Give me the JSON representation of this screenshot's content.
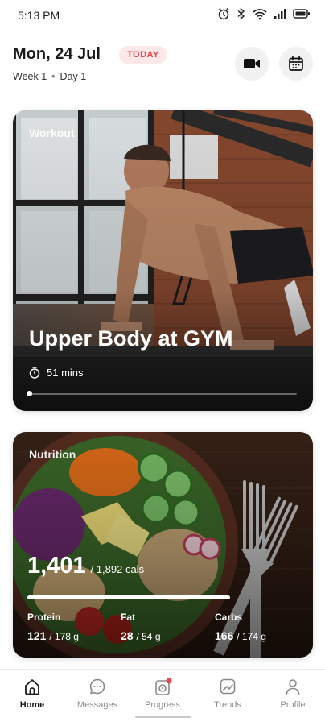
{
  "status_bar": {
    "time": "5:13 PM",
    "icons": [
      "alarm-icon",
      "bluetooth-icon",
      "wifi-icon",
      "signal-icon",
      "battery-icon"
    ]
  },
  "header": {
    "date": "Mon, 24 Jul",
    "today_badge": "TODAY",
    "week": "Week 1",
    "day": "Day 1",
    "actions": [
      "video-camera-icon",
      "calendar-icon"
    ],
    "badge_color": "#e5484d"
  },
  "workout": {
    "label": "Workout",
    "title": "Upper Body at GYM",
    "duration": "51 mins",
    "progress": 0.0
  },
  "nutrition": {
    "label": "Nutrition",
    "calories_consumed": "1,401",
    "calories_goal_text": "/ 1,892 cals",
    "calories_fraction": 0.74,
    "macros": [
      {
        "label": "Protein",
        "value": "121",
        "total": "/ 178 g"
      },
      {
        "label": "Fat",
        "value": "28",
        "total": "/ 54 g"
      },
      {
        "label": "Carbs",
        "value": "166",
        "total": "/ 174 g"
      }
    ]
  },
  "bottom_nav": {
    "items": [
      {
        "label": "Home",
        "icon": "home-icon",
        "active": true
      },
      {
        "label": "Messages",
        "icon": "messages-icon",
        "active": false
      },
      {
        "label": "Progress",
        "icon": "progress-icon",
        "active": false,
        "notification_dot": true
      },
      {
        "label": "Trends",
        "icon": "trends-icon",
        "active": false
      },
      {
        "label": "Profile",
        "icon": "profile-icon",
        "active": false
      }
    ]
  }
}
